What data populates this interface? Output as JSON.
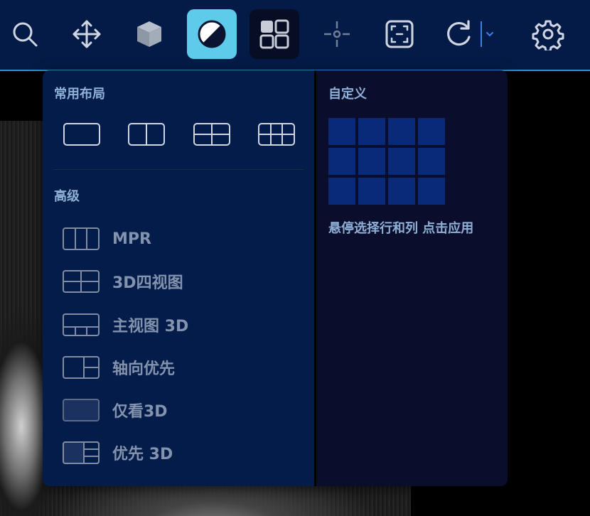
{
  "toolbar": {
    "tools": [
      {
        "name": "search-icon"
      },
      {
        "name": "move-icon"
      },
      {
        "name": "cube-icon"
      },
      {
        "name": "contrast-icon",
        "state": "active"
      },
      {
        "name": "layout-grid-icon",
        "state": "selected"
      },
      {
        "name": "crosshair-icon"
      },
      {
        "name": "fit-frame-icon"
      },
      {
        "name": "redo-icon"
      },
      {
        "name": "chevron-down-icon"
      },
      {
        "name": "gear-icon"
      }
    ],
    "colors": {
      "bar": "#051b47",
      "active": "#5ecbea",
      "selected": "#070d24",
      "accent": "#3d80e8"
    }
  },
  "layout_menu": {
    "common": {
      "title": "常用布局",
      "options": [
        "1x1",
        "1x2",
        "2x2",
        "2x3"
      ]
    },
    "advanced": {
      "title": "高级",
      "items": [
        {
          "label": "MPR",
          "icon": "mpr-layout-icon"
        },
        {
          "label": "3D四视图",
          "icon": "four-view-layout-icon"
        },
        {
          "label": "主视图 3D",
          "icon": "main-view-layout-icon"
        },
        {
          "label": "轴向优先",
          "icon": "axial-first-layout-icon"
        },
        {
          "label": "仅看3D",
          "icon": "only-3d-layout-icon"
        },
        {
          "label": "优先 3D",
          "icon": "3d-first-layout-icon"
        }
      ]
    },
    "custom": {
      "title": "自定义",
      "rows": 3,
      "cols": 4,
      "hint": "悬停选择行和列 点击应用"
    }
  }
}
